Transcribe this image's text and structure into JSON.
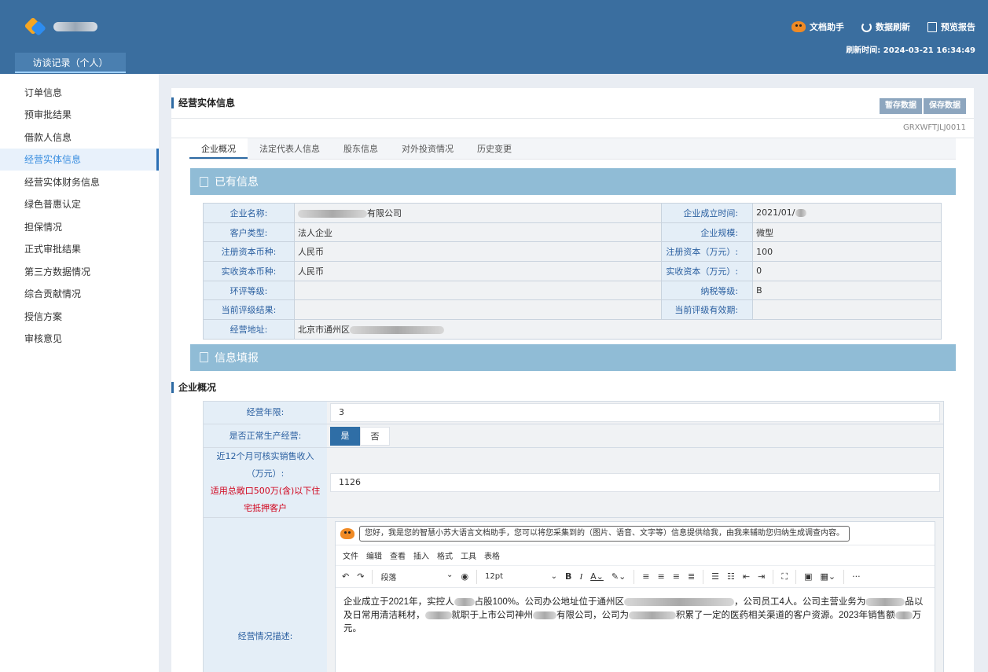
{
  "header": {
    "module_tab": "访谈记录（个人）",
    "doc_assistant": "文档助手",
    "data_refresh": "数据刷新",
    "preview_report": "预览报告",
    "refresh_time": "刷新时间: 2024-03-21 16:34:49"
  },
  "sidebar": {
    "items": [
      {
        "label": "订单信息"
      },
      {
        "label": "预审批结果"
      },
      {
        "label": "借款人信息"
      },
      {
        "label": "经营实体信息"
      },
      {
        "label": "经营实体财务信息"
      },
      {
        "label": "绿色普惠认定"
      },
      {
        "label": "担保情况"
      },
      {
        "label": "正式审批结果"
      },
      {
        "label": "第三方数据情况"
      },
      {
        "label": "综合贡献情况"
      },
      {
        "label": "授信方案"
      },
      {
        "label": "审核意见"
      }
    ],
    "active_index": 3
  },
  "main": {
    "title": "经营实体信息",
    "temp_save": "暂存数据",
    "save": "保存数据",
    "code": "GRXWFTJLJ0011",
    "tabs": [
      "企业概况",
      "法定代表人信息",
      "股东信息",
      "对外投资情况",
      "历史变更"
    ]
  },
  "existing": {
    "section_title": "已有信息",
    "rows": [
      {
        "l1": "企业名称:",
        "v1": "有限公司",
        "l2": "企业成立时间:",
        "v2": "2021/01/"
      },
      {
        "l1": "客户类型:",
        "v1": "法人企业",
        "l2": "企业规模:",
        "v2": "微型"
      },
      {
        "l1": "注册资本币种:",
        "v1": "人民币",
        "l2": "注册资本（万元）:",
        "v2": "100"
      },
      {
        "l1": "实收资本币种:",
        "v1": "人民币",
        "l2": "实收资本（万元）:",
        "v2": "0"
      },
      {
        "l1": "环评等级:",
        "v1": "",
        "l2": "纳税等级:",
        "v2": "B"
      },
      {
        "l1": "当前评级结果:",
        "v1": "",
        "l2": "当前评级有效期:",
        "v2": ""
      },
      {
        "l1": "经营地址:",
        "v1": "北京市通州区"
      }
    ]
  },
  "fill": {
    "section_title": "信息填报",
    "sub_title": "企业概况",
    "years_label": "经营年限:",
    "years_value": "3",
    "normal_label": "是否正常生产经营:",
    "yes": "是",
    "no": "否",
    "revenue_label_1": "近12个月可核实销售收入（万元）:",
    "revenue_label_2": "适用总敞口500万(含)以下住宅抵押客户",
    "revenue_value": "1126",
    "desc_label": "经营情况描述:"
  },
  "editor": {
    "assistant_tip": "您好，我是您的智慧小苏大语言文档助手，您可以将您采集到的（图片、语音、文字等）信息提供给我，由我来辅助您归纳生成调查内容。",
    "menus": [
      "文件",
      "编辑",
      "查看",
      "插入",
      "格式",
      "工具",
      "表格"
    ],
    "block_format": "段落",
    "font_size": "12pt",
    "content_parts": [
      "企业成立于2021年，实控人",
      "占股100%。公司办公地址位于通州区",
      "，公司员工4人。公司主营业务为",
      "品以及日常用清洁耗材，",
      "就职于上市公司神州",
      "有限公司，公司为",
      "积累了一定的医药相关渠道的客户资源。2023年销售额",
      "万元。"
    ]
  }
}
